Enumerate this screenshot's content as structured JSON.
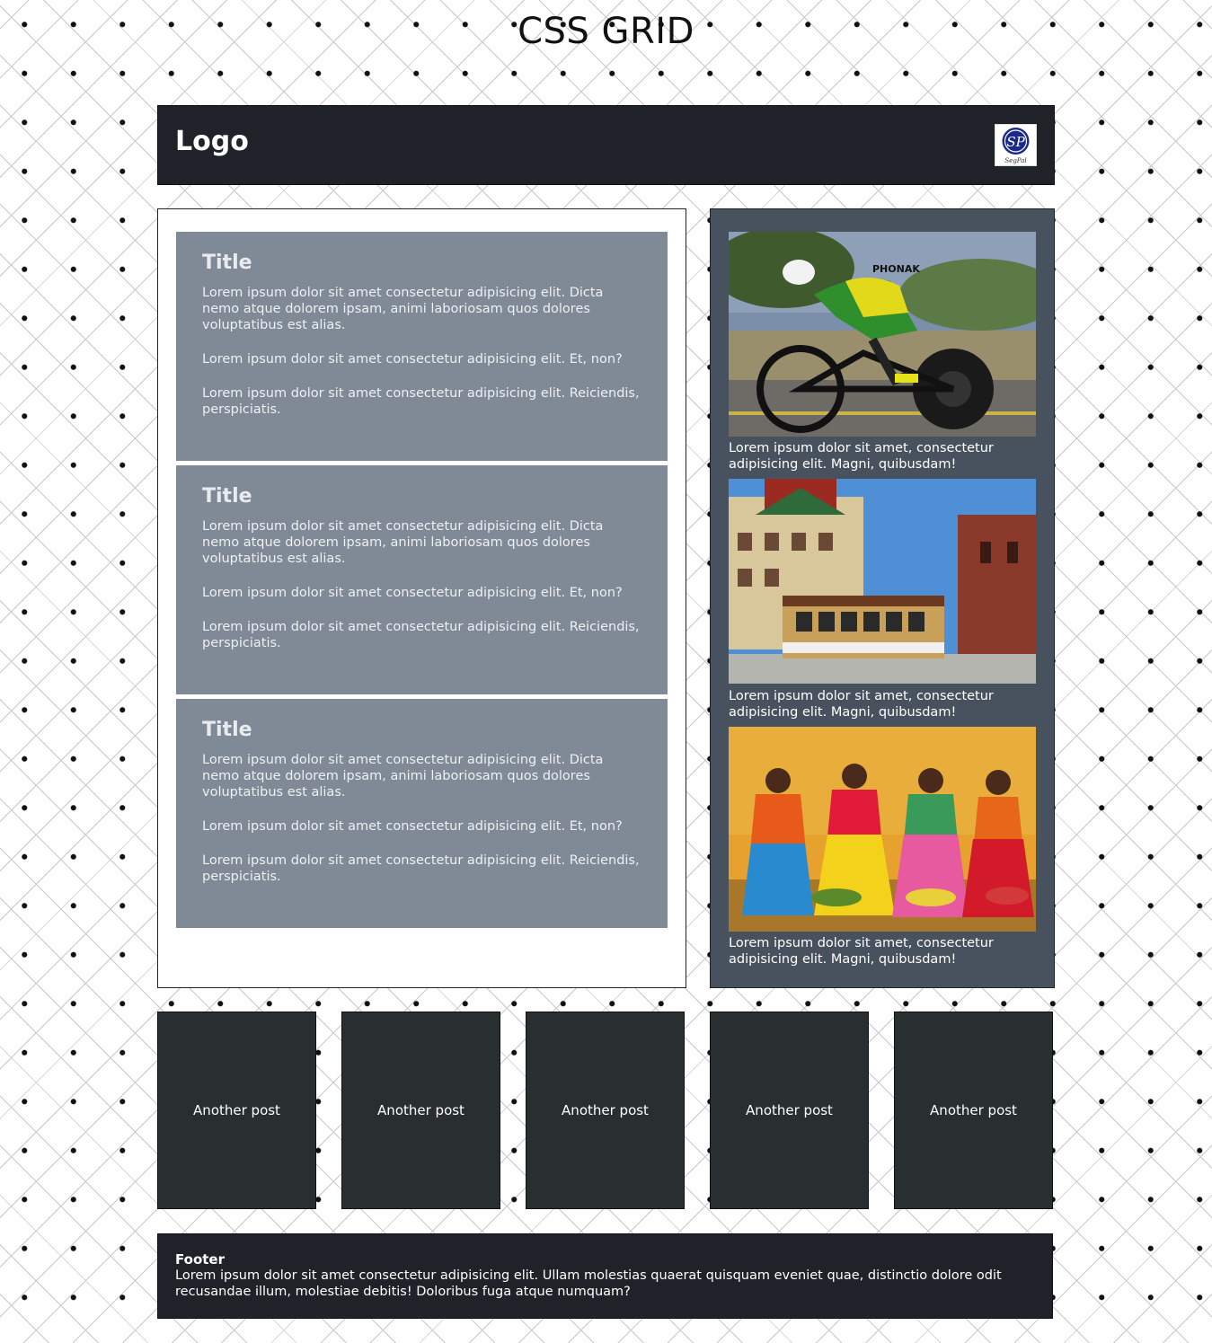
{
  "page": {
    "title": "CSS GRID"
  },
  "header": {
    "logo": "Logo",
    "profile_text": "SegPal"
  },
  "cards": [
    {
      "title": "Title",
      "paragraphs": [
        "Lorem ipsum dolor sit amet consectetur adipisicing elit. Dicta nemo atque dolorem ipsam, animi laboriosam quos dolores voluptatibus est alias.",
        "Lorem ipsum dolor sit amet consectetur adipisicing elit. Et, non?",
        "Lorem ipsum dolor sit amet consectetur adipisicing elit. Reiciendis, perspiciatis."
      ]
    },
    {
      "title": "Title",
      "paragraphs": [
        "Lorem ipsum dolor sit amet consectetur adipisicing elit. Dicta nemo atque dolorem ipsam, animi laboriosam quos dolores voluptatibus est alias.",
        "Lorem ipsum dolor sit amet consectetur adipisicing elit. Et, non?",
        "Lorem ipsum dolor sit amet consectetur adipisicing elit. Reiciendis, perspiciatis."
      ]
    },
    {
      "title": "Title",
      "paragraphs": [
        "Lorem ipsum dolor sit amet consectetur adipisicing elit. Dicta nemo atque dolorem ipsam, animi laboriosam quos dolores voluptatibus est alias.",
        "Lorem ipsum dolor sit amet consectetur adipisicing elit. Et, non?",
        "Lorem ipsum dolor sit amet consectetur adipisicing elit. Reiciendis, perspiciatis."
      ]
    }
  ],
  "sidebar": {
    "items": [
      {
        "caption": "Lorem ipsum dolor sit amet, consectetur adipisicing elit. Magni, quibusdam!",
        "jersey_text": "PHONAK"
      },
      {
        "caption": "Lorem ipsum dolor sit amet, consectetur adipisicing elit. Magni, quibusdam!"
      },
      {
        "caption": "Lorem ipsum dolor sit amet, consectetur adipisicing elit. Magni, quibusdam!"
      }
    ]
  },
  "posts": [
    {
      "label": "Another post"
    },
    {
      "label": "Another post"
    },
    {
      "label": "Another post"
    },
    {
      "label": "Another post"
    },
    {
      "label": "Another post"
    }
  ],
  "footer": {
    "title": "Footer",
    "text": "Lorem ipsum dolor sit amet consectetur adipisicing elit. Ullam molestias quaerat quisquam eveniet quae, distinctio dolore odit recusandae illum, molestiae debitis! Doloribus fuga atque numquam?"
  },
  "colors": {
    "header_bg": "#1f2329",
    "card_bg": "#7f8a96",
    "sidebar_bg": "#48525e",
    "post_bg": "#292e31"
  }
}
